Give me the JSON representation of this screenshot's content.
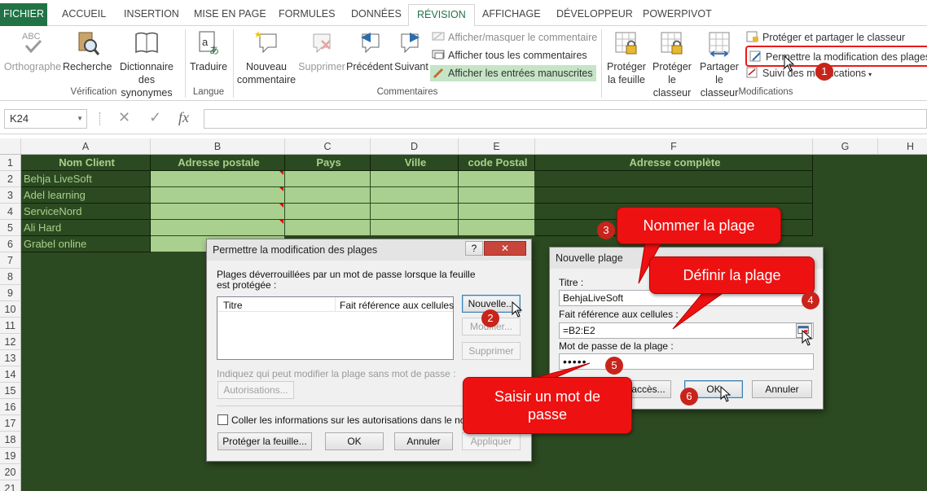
{
  "tabs": [
    {
      "label": "FICHIER"
    },
    {
      "label": "ACCUEIL"
    },
    {
      "label": "INSERTION"
    },
    {
      "label": "MISE EN PAGE"
    },
    {
      "label": "FORMULES"
    },
    {
      "label": "DONNÉES"
    },
    {
      "label": "RÉVISION"
    },
    {
      "label": "AFFICHAGE"
    },
    {
      "label": "DÉVELOPPEUR"
    },
    {
      "label": "POWERPIVOT"
    }
  ],
  "ribbon": {
    "verification": {
      "orthographe": "Orthographe",
      "recherche": "Recherche",
      "dict1": "Dictionnaire",
      "dict2": "des synonymes",
      "group": "Vérification",
      "abc": "ABC"
    },
    "langue": {
      "traduire": "Traduire",
      "group": "Langue"
    },
    "commentaires": {
      "nouveau1": "Nouveau",
      "nouveau2": "commentaire",
      "supprimer": "Supprimer",
      "precedent": "Précédent",
      "suivant": "Suivant",
      "afficher_masquer": "Afficher/masquer le commentaire",
      "afficher_tous": "Afficher tous les commentaires",
      "afficher_entrees": "Afficher les entrées manuscrites",
      "group": "Commentaires"
    },
    "modifications": {
      "proteger_feuille1": "Protéger",
      "proteger_feuille2": "la feuille",
      "proteger_classeur1": "Protéger",
      "proteger_classeur2": "le classeur",
      "partager1": "Partager",
      "partager2": "le classeur",
      "proteger_partager": "Protéger et partager le classeur",
      "permettre": "Permettre la modification des plages",
      "suivi": "Suivi des modifications",
      "group": "Modifications"
    }
  },
  "formula_bar": {
    "name_box": "K24",
    "fx": "fx",
    "cancel": "✕",
    "enter": "✓",
    "formula": ""
  },
  "sheet": {
    "columns": [
      "A",
      "B",
      "C",
      "D",
      "E",
      "F",
      "G",
      "H"
    ],
    "rows": [
      "1",
      "2",
      "3",
      "4",
      "5",
      "6",
      "7",
      "8",
      "9",
      "10",
      "11",
      "12",
      "13",
      "14",
      "15",
      "16",
      "17",
      "18",
      "19",
      "20",
      "21"
    ],
    "headers": [
      "Nom Client",
      "Adresse postale",
      "Pays",
      "Ville",
      "code Postal",
      "Adresse complète"
    ],
    "clients": [
      "Behja LiveSoft",
      "Adel learning",
      "ServiceNord",
      "Ali Hard",
      "Grabel online"
    ]
  },
  "dialog_plages": {
    "title": "Permettre la modification des plages",
    "help": "?",
    "close": "✕",
    "desc": "Plages déverrouillées par un mot de passe lorsque la feuille est protégée :",
    "col_titre": "Titre",
    "col_ref": "Fait référence aux cellules",
    "btn_nouvelle": "Nouvelle...",
    "btn_modifier": "Modifier...",
    "btn_supprimer": "Supprimer",
    "indiquez": "Indiquez qui peut modifier la plage sans mot de passe :",
    "btn_autorisations": "Autorisations...",
    "coller": "Coller les informations sur les autorisations dans le nou",
    "btn_proteger": "Protéger la feuille...",
    "btn_ok": "OK",
    "btn_annuler": "Annuler",
    "btn_appliquer": "Appliquer"
  },
  "dialog_nouvelle": {
    "title": "Nouvelle plage",
    "lbl_titre": "Titre :",
    "val_titre": "BehjaLiveSoft",
    "lbl_ref": "Fait référence aux cellules :",
    "val_ref": "=B2:E2",
    "lbl_mdp": "Mot de passe de la plage :",
    "val_mdp": "•••••",
    "btn_acces": "accès...",
    "btn_ok": "OK",
    "btn_annuler": "Annuler"
  },
  "callouts": {
    "nommer": "Nommer la plage",
    "definir": "Définir la plage",
    "saisir": "Saisir un mot de passe"
  },
  "badges": [
    "1",
    "2",
    "3",
    "4",
    "5",
    "6"
  ],
  "colors": {
    "excel_green": "#217346",
    "sheet_bg": "#2c4a21",
    "cell_green": "#a9d08e",
    "callout_red": "#ee1111"
  }
}
